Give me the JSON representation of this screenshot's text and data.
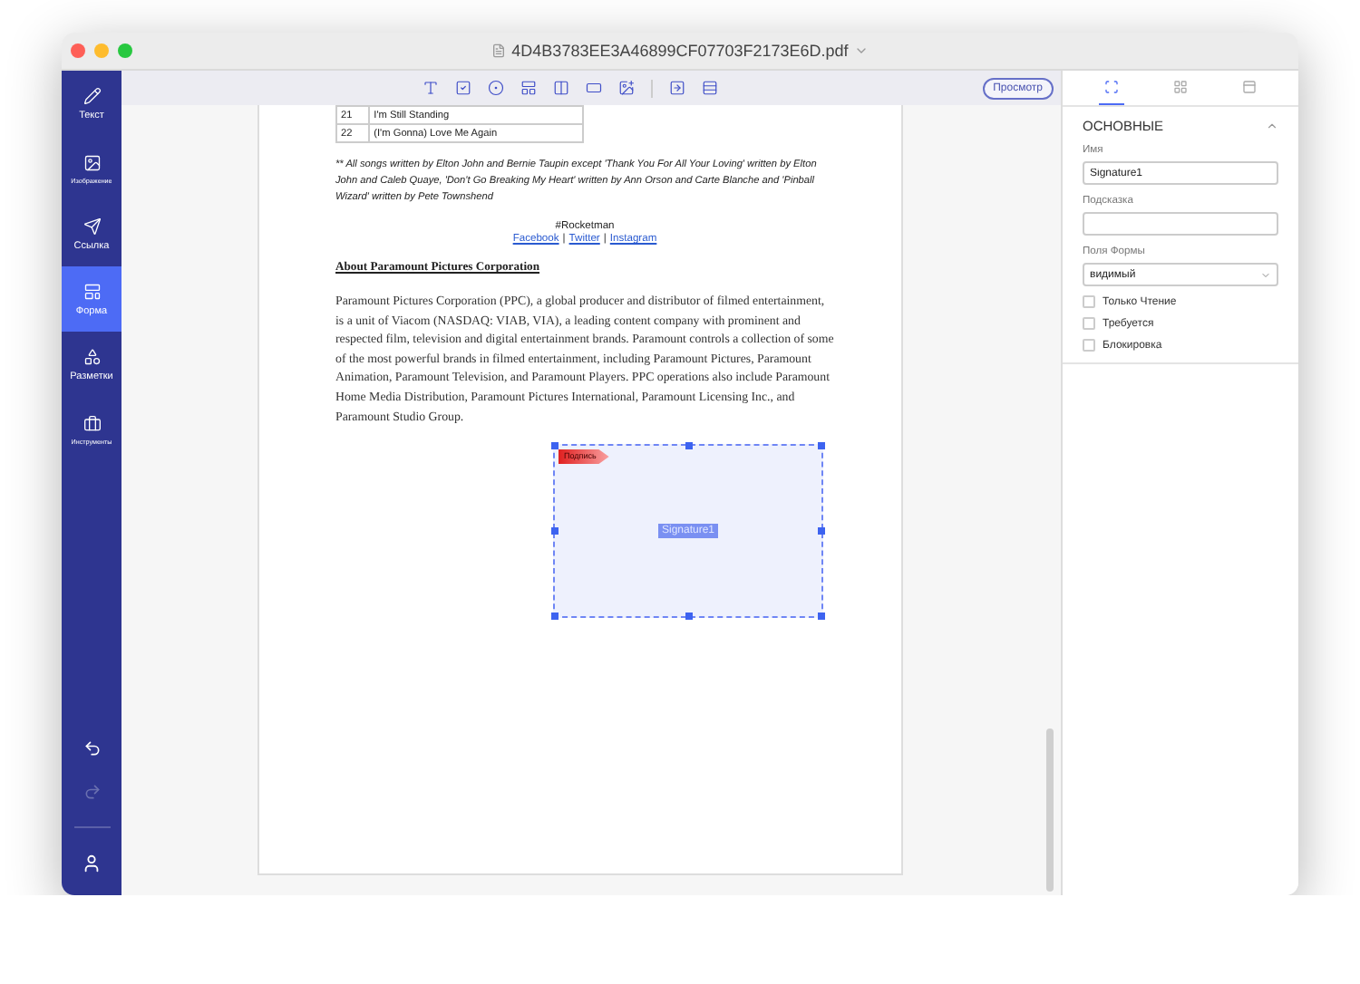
{
  "window": {
    "title": "4D4B3783EE3A46899CF07703F2173E6D.pdf"
  },
  "sidebar": {
    "items": [
      {
        "label": "Текст",
        "selected": false
      },
      {
        "label": "Изображение",
        "selected": false
      },
      {
        "label": "Ссылка",
        "selected": false
      },
      {
        "label": "Форма",
        "selected": true
      },
      {
        "label": "Разметки",
        "selected": false
      },
      {
        "label": "Инструменты",
        "selected": false
      }
    ],
    "undo": {
      "disabled": false
    },
    "redo": {
      "disabled": true
    }
  },
  "toolbar": {
    "preview_button": "Просмотр"
  },
  "document": {
    "table_rows": [
      {
        "number": "21",
        "title": "I'm Still Standing"
      },
      {
        "number": "22",
        "title": "(I'm Gonna) Love Me Again"
      }
    ],
    "footnote": "** All songs written by Elton John and Bernie Taupin except 'Thank You For All Your Loving' written by Elton John and Caleb Quaye, 'Don't Go Breaking My Heart' written by Ann Orson and Carte Blanche and 'Pinball Wizard' written by Pete Townshend",
    "hashtag": "#Rocketman",
    "links": [
      "Facebook",
      "Twitter",
      "Instagram"
    ],
    "link_separator": "|",
    "heading": "About Paramount Pictures Corporation",
    "paragraph": "Paramount Pictures Corporation (PPC), a global producer and distributor of filmed entertainment, is a unit of Viacom (NASDAQ: VIAB, VIA), a leading content company with prominent and respected film, television and digital entertainment brands. Paramount controls a collection of some of the most powerful brands in filmed entertainment, including Paramount Pictures, Paramount Animation, Paramount Television, and Paramount Players. PPC operations also include Paramount Home Media Distribution, Paramount Pictures International, Paramount Licensing Inc., and Paramount Studio Group.",
    "signature_field": {
      "tag": "Подпись",
      "name": "Signature1",
      "selected": true
    }
  },
  "panel": {
    "tabs": [
      {
        "selected": true
      },
      {
        "selected": false
      },
      {
        "selected": false
      }
    ],
    "section": {
      "title": "ОСНОВНЫЕ",
      "expanded": true
    },
    "name_field": {
      "label": "Имя",
      "value": "Signature1"
    },
    "hint_field": {
      "label": "Подсказка"
    },
    "visibility_field": {
      "label": "Поля Формы",
      "value": "видимый"
    },
    "checkboxes": [
      {
        "label": "Только Чтение",
        "checked": false
      },
      {
        "label": "Требуется",
        "checked": false
      },
      {
        "label": "Блокировка",
        "checked": false
      }
    ]
  }
}
